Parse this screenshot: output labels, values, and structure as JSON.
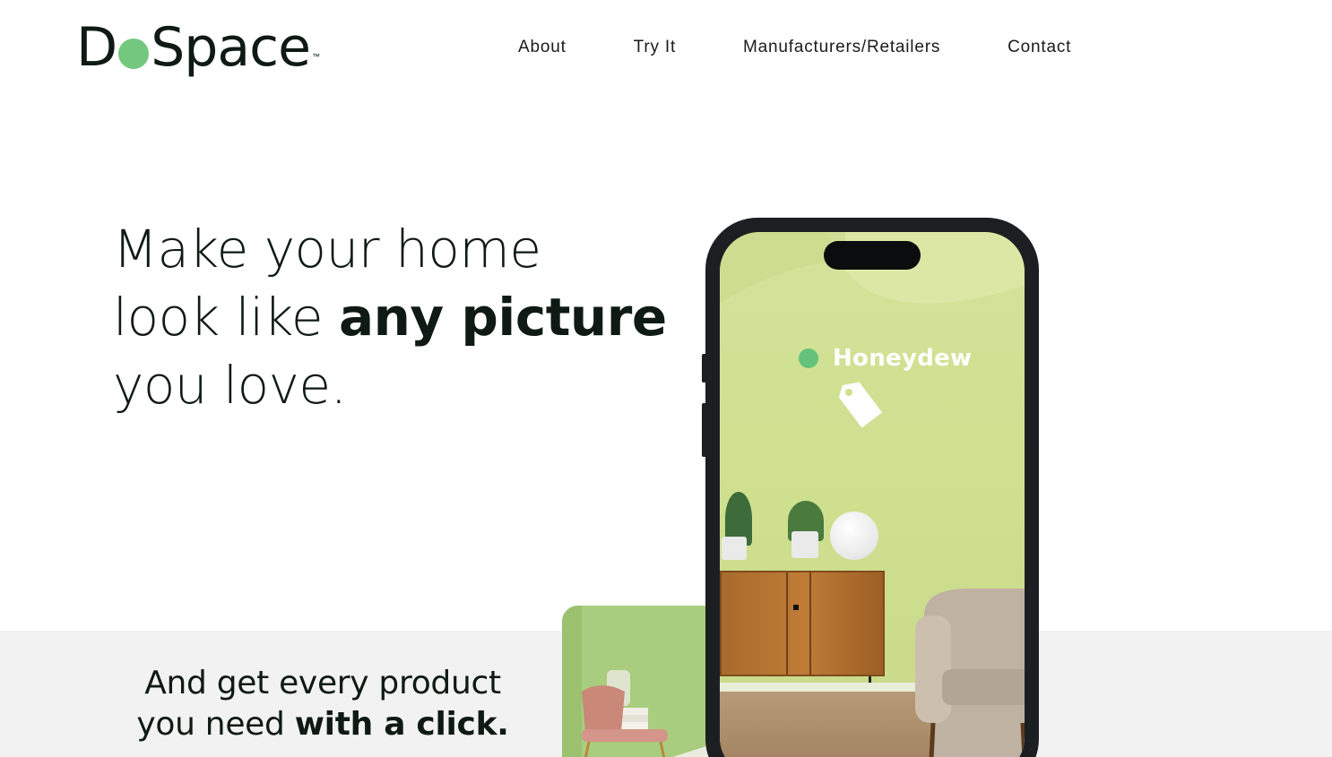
{
  "header": {
    "logo": {
      "prefix": "D",
      "suffix": "Space",
      "trademark": "™"
    },
    "nav": [
      {
        "label": "About"
      },
      {
        "label": "Try It"
      },
      {
        "label": "Manufacturers/Retailers"
      },
      {
        "label": "Contact"
      }
    ]
  },
  "hero": {
    "line1": "Make your home",
    "line2_regular": "look like ",
    "line2_bold": "any picture",
    "line3": "you love."
  },
  "phone": {
    "color_name": "Honeydew",
    "color_dot": "#64c27a",
    "wall_color": "#d3e29a",
    "icons": [
      "price-tag-icon"
    ]
  },
  "subhead": {
    "line1": "And get every product",
    "line2_regular": "you need ",
    "line2_bold": "with a click."
  },
  "colors": {
    "brand_dark": "#0f1a14",
    "brand_green": "#74c77e",
    "band_gray": "#f2f2f2"
  }
}
